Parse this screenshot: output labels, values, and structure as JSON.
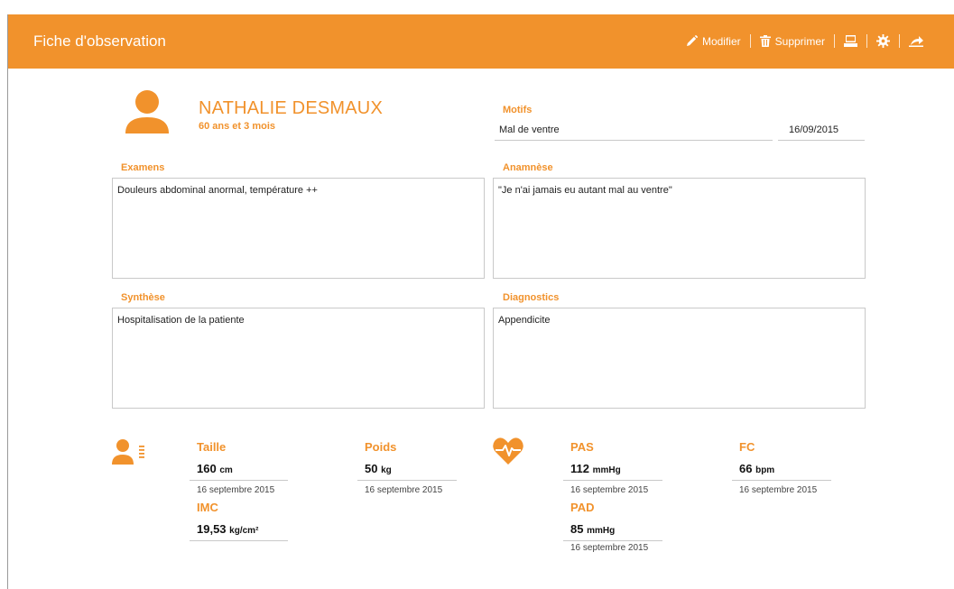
{
  "window": {
    "title": "Fiche d'observation"
  },
  "toolbar": {
    "edit_label": "Modifier",
    "delete_label": "Supprimer",
    "icons": [
      "pencil-icon",
      "trash-icon",
      "print-icon",
      "gear-icon",
      "share-icon"
    ]
  },
  "patient": {
    "name": "NATHALIE DESMAUX",
    "age": "60 ans et 3 mois"
  },
  "motifs": {
    "label": "Motifs",
    "value": "Mal de ventre",
    "date": "16/09/2015"
  },
  "examens": {
    "label": "Examens",
    "value": "Douleurs abdominal anormal, température ++"
  },
  "anamnese": {
    "label": "Anamnèse",
    "value": "\"Je n'ai jamais eu autant mal au ventre\""
  },
  "synthese": {
    "label": "Synthèse",
    "value": "Hospitalisation de la patiente"
  },
  "diagnostics": {
    "label": "Diagnostics",
    "value": "Appendicite"
  },
  "vitals": {
    "taille": {
      "label": "Taille",
      "value": "160",
      "unit": "cm",
      "date": "16 septembre 2015"
    },
    "poids": {
      "label": "Poids",
      "value": "50",
      "unit": "kg",
      "date": "16 septembre 2015"
    },
    "imc": {
      "label": "IMC",
      "value": "19,53",
      "unit": "kg/cm²"
    },
    "pas": {
      "label": "PAS",
      "value": "112",
      "unit": "mmHg",
      "date": "16 septembre 2015"
    },
    "fc": {
      "label": "FC",
      "value": "66",
      "unit": "bpm",
      "date": "16 septembre 2015"
    },
    "pad": {
      "label": "PAD",
      "value": "85",
      "unit": "mmHg",
      "date": "16 septembre 2015"
    }
  },
  "colors": {
    "accent": "#f1922c",
    "border": "#c9c9c9"
  }
}
